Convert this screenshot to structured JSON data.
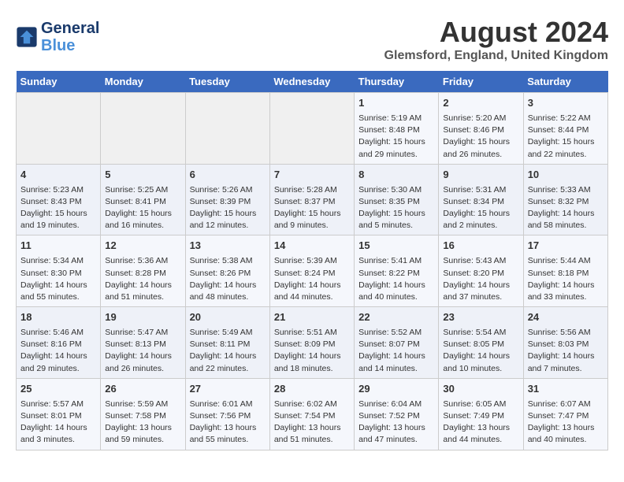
{
  "header": {
    "logo_line1": "General",
    "logo_line2": "Blue",
    "month_year": "August 2024",
    "location": "Glemsford, England, United Kingdom"
  },
  "weekdays": [
    "Sunday",
    "Monday",
    "Tuesday",
    "Wednesday",
    "Thursday",
    "Friday",
    "Saturday"
  ],
  "weeks": [
    [
      {
        "day": "",
        "info": ""
      },
      {
        "day": "",
        "info": ""
      },
      {
        "day": "",
        "info": ""
      },
      {
        "day": "",
        "info": ""
      },
      {
        "day": "1",
        "info": "Sunrise: 5:19 AM\nSunset: 8:48 PM\nDaylight: 15 hours\nand 29 minutes."
      },
      {
        "day": "2",
        "info": "Sunrise: 5:20 AM\nSunset: 8:46 PM\nDaylight: 15 hours\nand 26 minutes."
      },
      {
        "day": "3",
        "info": "Sunrise: 5:22 AM\nSunset: 8:44 PM\nDaylight: 15 hours\nand 22 minutes."
      }
    ],
    [
      {
        "day": "4",
        "info": "Sunrise: 5:23 AM\nSunset: 8:43 PM\nDaylight: 15 hours\nand 19 minutes."
      },
      {
        "day": "5",
        "info": "Sunrise: 5:25 AM\nSunset: 8:41 PM\nDaylight: 15 hours\nand 16 minutes."
      },
      {
        "day": "6",
        "info": "Sunrise: 5:26 AM\nSunset: 8:39 PM\nDaylight: 15 hours\nand 12 minutes."
      },
      {
        "day": "7",
        "info": "Sunrise: 5:28 AM\nSunset: 8:37 PM\nDaylight: 15 hours\nand 9 minutes."
      },
      {
        "day": "8",
        "info": "Sunrise: 5:30 AM\nSunset: 8:35 PM\nDaylight: 15 hours\nand 5 minutes."
      },
      {
        "day": "9",
        "info": "Sunrise: 5:31 AM\nSunset: 8:34 PM\nDaylight: 15 hours\nand 2 minutes."
      },
      {
        "day": "10",
        "info": "Sunrise: 5:33 AM\nSunset: 8:32 PM\nDaylight: 14 hours\nand 58 minutes."
      }
    ],
    [
      {
        "day": "11",
        "info": "Sunrise: 5:34 AM\nSunset: 8:30 PM\nDaylight: 14 hours\nand 55 minutes."
      },
      {
        "day": "12",
        "info": "Sunrise: 5:36 AM\nSunset: 8:28 PM\nDaylight: 14 hours\nand 51 minutes."
      },
      {
        "day": "13",
        "info": "Sunrise: 5:38 AM\nSunset: 8:26 PM\nDaylight: 14 hours\nand 48 minutes."
      },
      {
        "day": "14",
        "info": "Sunrise: 5:39 AM\nSunset: 8:24 PM\nDaylight: 14 hours\nand 44 minutes."
      },
      {
        "day": "15",
        "info": "Sunrise: 5:41 AM\nSunset: 8:22 PM\nDaylight: 14 hours\nand 40 minutes."
      },
      {
        "day": "16",
        "info": "Sunrise: 5:43 AM\nSunset: 8:20 PM\nDaylight: 14 hours\nand 37 minutes."
      },
      {
        "day": "17",
        "info": "Sunrise: 5:44 AM\nSunset: 8:18 PM\nDaylight: 14 hours\nand 33 minutes."
      }
    ],
    [
      {
        "day": "18",
        "info": "Sunrise: 5:46 AM\nSunset: 8:16 PM\nDaylight: 14 hours\nand 29 minutes."
      },
      {
        "day": "19",
        "info": "Sunrise: 5:47 AM\nSunset: 8:13 PM\nDaylight: 14 hours\nand 26 minutes."
      },
      {
        "day": "20",
        "info": "Sunrise: 5:49 AM\nSunset: 8:11 PM\nDaylight: 14 hours\nand 22 minutes."
      },
      {
        "day": "21",
        "info": "Sunrise: 5:51 AM\nSunset: 8:09 PM\nDaylight: 14 hours\nand 18 minutes."
      },
      {
        "day": "22",
        "info": "Sunrise: 5:52 AM\nSunset: 8:07 PM\nDaylight: 14 hours\nand 14 minutes."
      },
      {
        "day": "23",
        "info": "Sunrise: 5:54 AM\nSunset: 8:05 PM\nDaylight: 14 hours\nand 10 minutes."
      },
      {
        "day": "24",
        "info": "Sunrise: 5:56 AM\nSunset: 8:03 PM\nDaylight: 14 hours\nand 7 minutes."
      }
    ],
    [
      {
        "day": "25",
        "info": "Sunrise: 5:57 AM\nSunset: 8:01 PM\nDaylight: 14 hours\nand 3 minutes."
      },
      {
        "day": "26",
        "info": "Sunrise: 5:59 AM\nSunset: 7:58 PM\nDaylight: 13 hours\nand 59 minutes."
      },
      {
        "day": "27",
        "info": "Sunrise: 6:01 AM\nSunset: 7:56 PM\nDaylight: 13 hours\nand 55 minutes."
      },
      {
        "day": "28",
        "info": "Sunrise: 6:02 AM\nSunset: 7:54 PM\nDaylight: 13 hours\nand 51 minutes."
      },
      {
        "day": "29",
        "info": "Sunrise: 6:04 AM\nSunset: 7:52 PM\nDaylight: 13 hours\nand 47 minutes."
      },
      {
        "day": "30",
        "info": "Sunrise: 6:05 AM\nSunset: 7:49 PM\nDaylight: 13 hours\nand 44 minutes."
      },
      {
        "day": "31",
        "info": "Sunrise: 6:07 AM\nSunset: 7:47 PM\nDaylight: 13 hours\nand 40 minutes."
      }
    ]
  ]
}
